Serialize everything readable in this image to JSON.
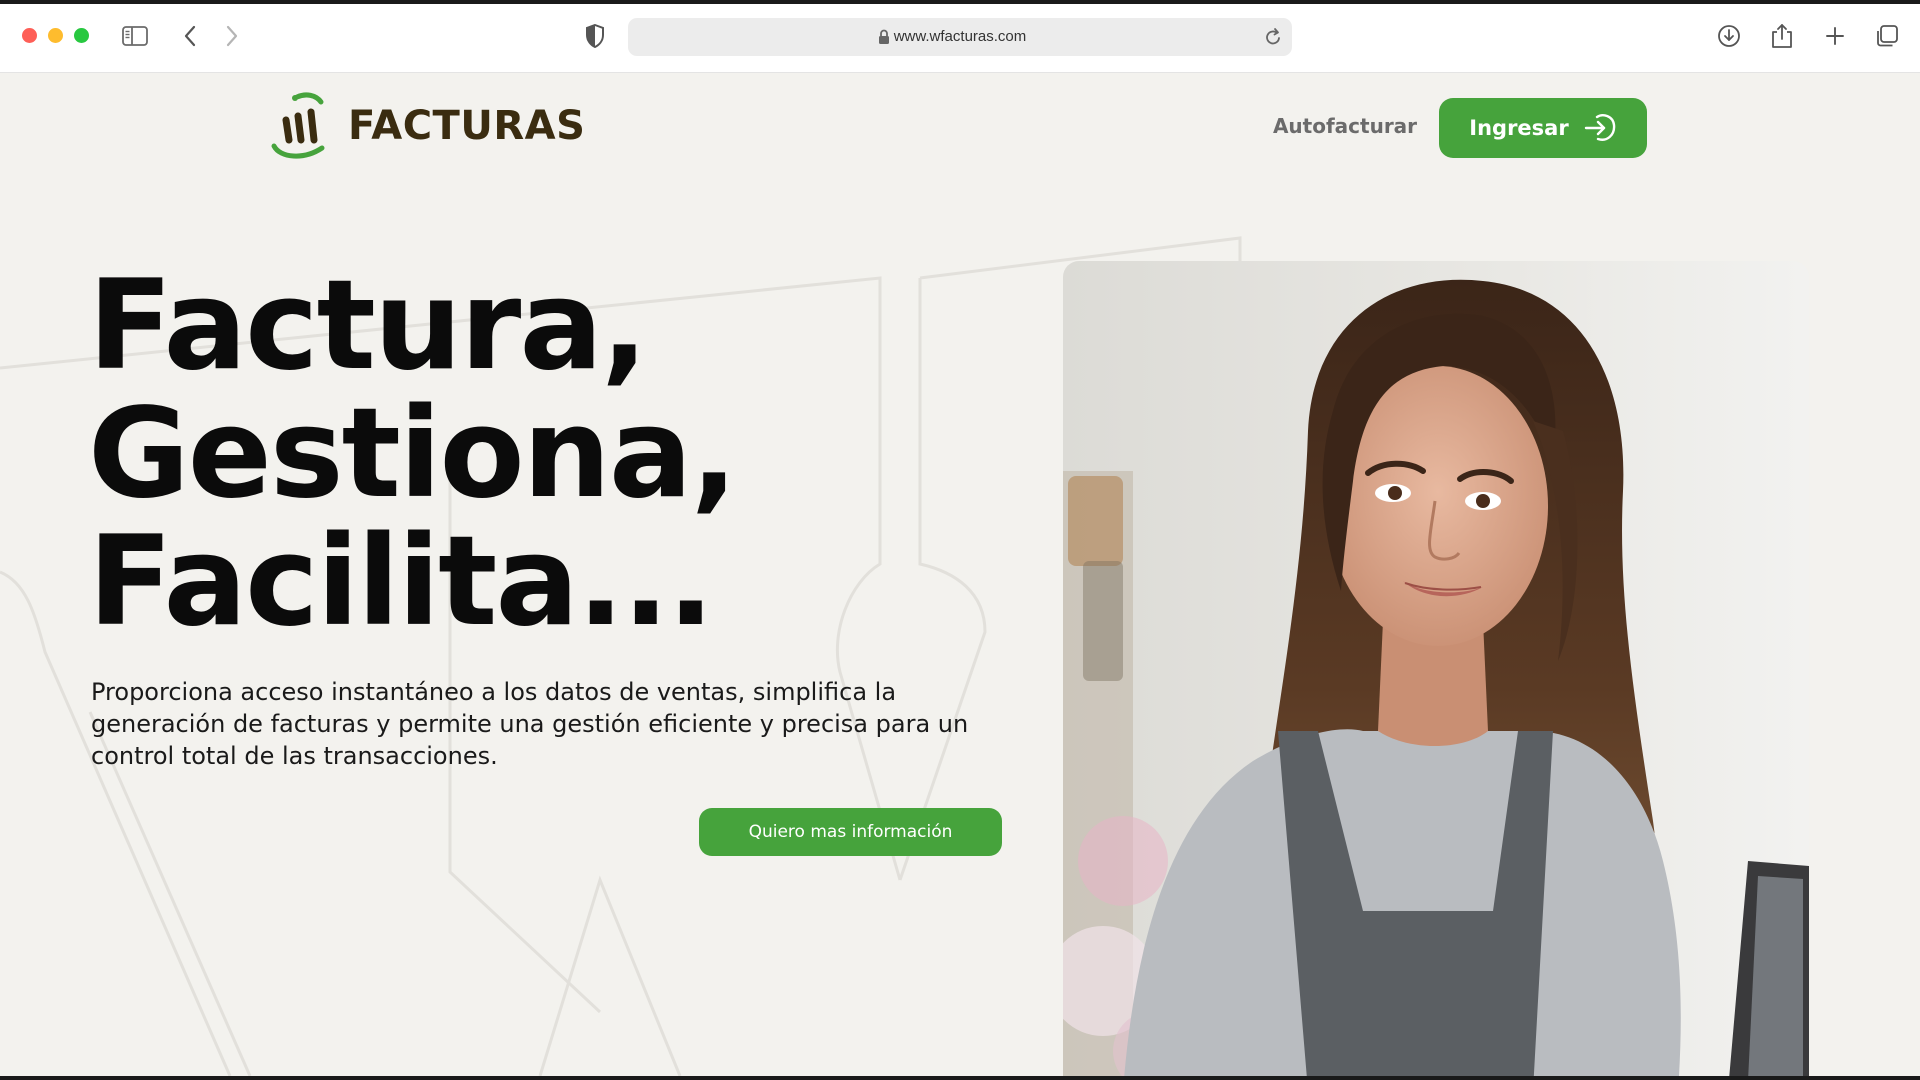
{
  "browser": {
    "url": "www.wfacturas.com"
  },
  "header": {
    "logo_text": "FACTURAS",
    "autofacturar_label": "Autofacturar",
    "login_label": "Ingresar"
  },
  "hero": {
    "title_line1": "Factura,",
    "title_line2": "Gestiona,",
    "title_line3": "Facilita...",
    "description": "Proporciona acceso instantáneo a los datos de ventas, simplifica la generación de facturas y permite una gestión eficiente y precisa para un control total de las transacciones.",
    "cta_label": "Quiero mas información"
  },
  "colors": {
    "brand_green": "#46a33c",
    "brand_brown": "#3a2c10",
    "page_bg": "#f3f2ee"
  },
  "icons": {
    "sidebar": "sidebar-icon",
    "back": "chevron-left-icon",
    "forward": "chevron-right-icon",
    "privacy": "shield-icon",
    "lock": "lock-icon",
    "reload": "reload-icon",
    "download": "download-icon",
    "share": "share-icon",
    "new_tab": "plus-icon",
    "tabs": "tabs-overview-icon",
    "login": "sign-in-icon"
  }
}
